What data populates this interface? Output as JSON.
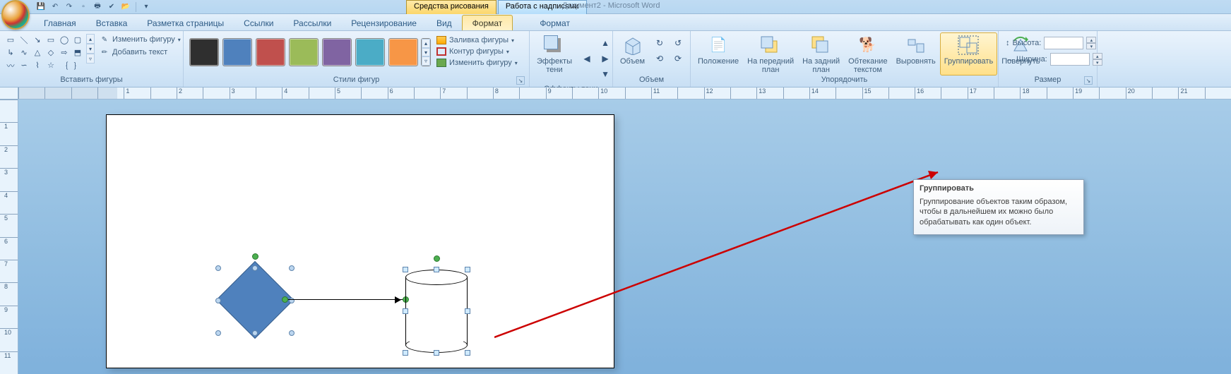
{
  "title": {
    "context_draw": "Средства рисования",
    "context_text": "Работа с надписями",
    "document": "Документ2 - Microsoft Word"
  },
  "tabs": {
    "home": "Главная",
    "insert": "Вставка",
    "layout": "Разметка страницы",
    "references": "Ссылки",
    "mailings": "Рассылки",
    "review": "Рецензирование",
    "view": "Вид",
    "format1": "Формат",
    "format2": "Формат"
  },
  "groups": {
    "insert_shapes": "Вставить фигуры",
    "shape_styles": "Стили фигур",
    "shadow": "Эффекты тени",
    "volume": "Объем",
    "arrange": "Упорядочить",
    "size": "Размер"
  },
  "insert_shapes": {
    "change_shape": "Изменить фигуру",
    "add_text": "Добавить текст"
  },
  "shape_styles": {
    "fill": "Заливка фигуры",
    "outline": "Контур фигуры",
    "change": "Изменить фигуру"
  },
  "shadow": {
    "effects": "Эффекты\nтени"
  },
  "volume": {
    "label": "Объем"
  },
  "arrange": {
    "position": "Положение",
    "bring_front": "На передний\nплан",
    "send_back": "На задний\nплан",
    "wrap": "Обтекание\nтекстом",
    "align": "Выровнять",
    "group": "Группировать",
    "rotate": "Повернуть"
  },
  "size": {
    "height": "Высота:",
    "width": "Ширина:",
    "height_val": "",
    "width_val": ""
  },
  "tooltip": {
    "title": "Группировать",
    "body": "Группирование объектов таким образом, чтобы в дальнейшем их можно было обрабатывать как один объект."
  },
  "swatch_colors": [
    "#2f2f2f",
    "#4f81bd",
    "#c0504d",
    "#9bbb59",
    "#8064a2",
    "#4bacc6",
    "#f79646"
  ]
}
